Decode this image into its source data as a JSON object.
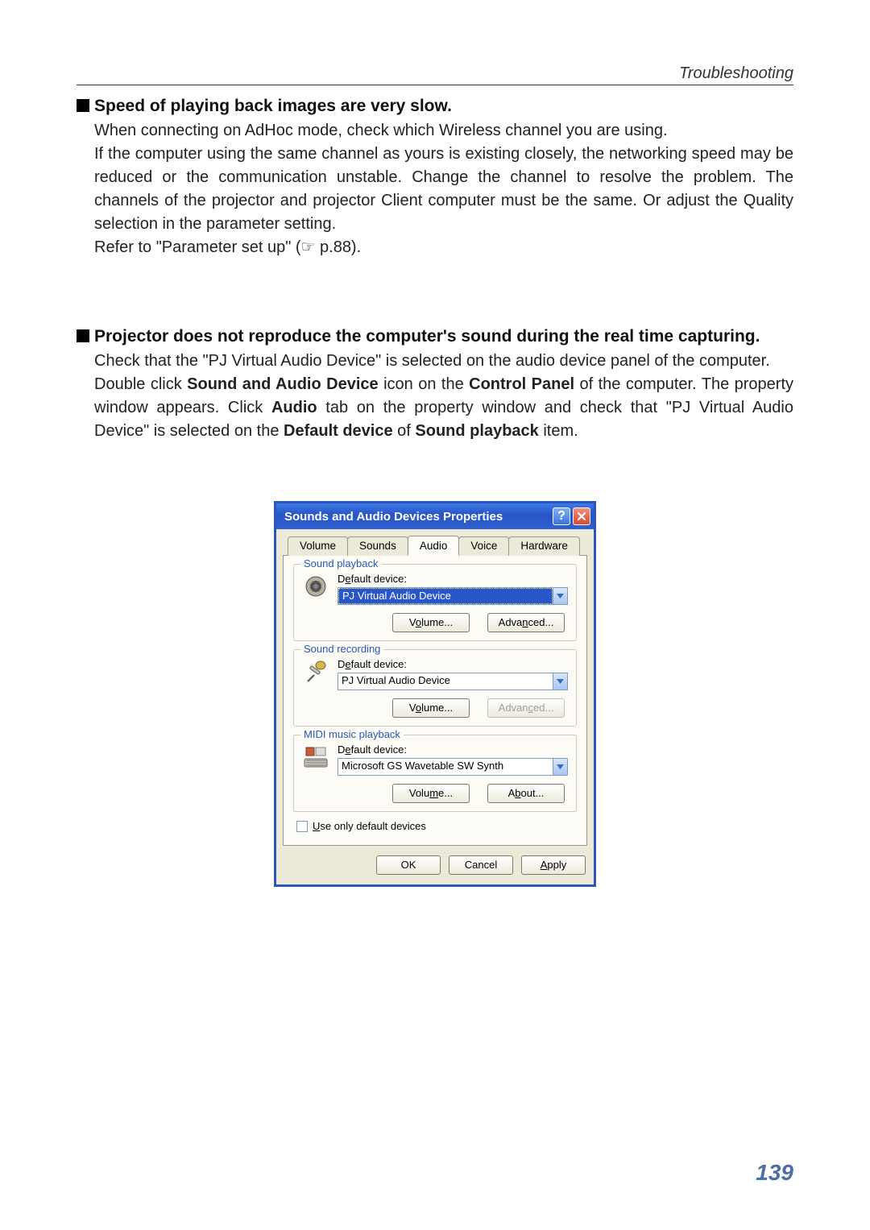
{
  "header": {
    "section": "Troubleshooting"
  },
  "section1": {
    "title": "Speed of playing back images are very slow.",
    "p1": "When connecting on AdHoc mode, check which Wireless channel you are using.",
    "p2": "If the computer using the same channel as yours is existing closely, the networking speed may be reduced or the communication unstable. Change the channel to resolve the problem. The channels of the projector and projector Client computer must be the same. Or adjust the Quality selection in the parameter setting.",
    "p3": "Refer to \"Parameter set up\" (☞ p.88)."
  },
  "section2": {
    "title": "Projector does not reproduce the computer's sound during the real time capturing.",
    "p1a": "Check that the \"PJ Virtual Audio Device\" is selected on the audio device panel of the computer.",
    "p1b_1": "Double click ",
    "p1b_bold1": "Sound and Audio Device",
    "p1b_2": " icon on the ",
    "p1b_bold2": "Control Panel",
    "p1b_3": " of the computer. The property window appears. Click ",
    "p1b_bold3": "Audio",
    "p1b_4": " tab on the property window and check that \"PJ Virtual Audio Device\" is selected on the ",
    "p1b_bold4": "Default device",
    "p1b_5": "  of ",
    "p1b_bold5": "Sound playback",
    "p1b_6": " item."
  },
  "dialog": {
    "title": "Sounds and Audio Devices Properties",
    "help": "?",
    "close": "×",
    "tabs": {
      "volume": "Volume",
      "sounds": "Sounds",
      "audio": "Audio",
      "voice": "Voice",
      "hardware": "Hardware"
    },
    "playback": {
      "legend": "Sound playback",
      "default_lbl_pre": "D",
      "default_lbl_u": "e",
      "default_lbl_post": "fault device:",
      "value": "PJ Virtual Audio Device",
      "volume_pre": "V",
      "volume_u": "o",
      "volume_post": "lume...",
      "adv_pre": "Adva",
      "adv_u": "n",
      "adv_post": "ced..."
    },
    "recording": {
      "legend": "Sound recording",
      "default_lbl_pre": "D",
      "default_lbl_u": "e",
      "default_lbl_post": "fault device:",
      "value": "PJ Virtual Audio Device",
      "volume_pre": "V",
      "volume_u": "o",
      "volume_post": "lume...",
      "adv_pre": "Advan",
      "adv_u": "c",
      "adv_post": "ed..."
    },
    "midi": {
      "legend": "MIDI music playback",
      "default_lbl_pre": "D",
      "default_lbl_u": "e",
      "default_lbl_post": "fault device:",
      "value": "Microsoft GS Wavetable SW Synth",
      "volume_pre": "Volu",
      "volume_u": "m",
      "volume_post": "e...",
      "about_pre": "A",
      "about_u": "b",
      "about_post": "out..."
    },
    "useonly_pre": "U",
    "useonly_u": "s",
    "useonly_val": "se only default devices",
    "btns": {
      "ok": "OK",
      "cancel": "Cancel",
      "apply_u": "A",
      "apply_post": "pply"
    }
  },
  "page_number": "139"
}
